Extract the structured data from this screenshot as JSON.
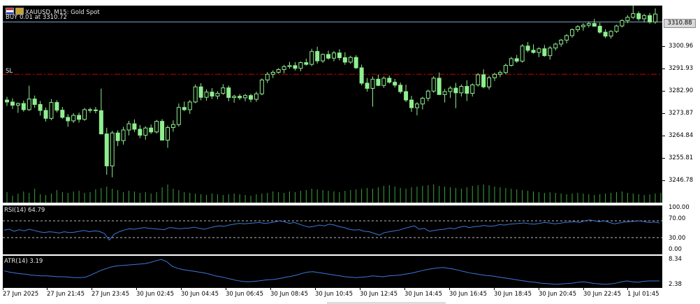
{
  "main": {
    "symbol_info": "XAUUSD, M15:  Gold Spot",
    "trade_info": "BUY 0.01 at 3310.72",
    "sl_label": "SL",
    "current_price": "3310.88",
    "price_labels": [
      "3300.96",
      "3291.93",
      "3282.90",
      "3273.87",
      "3264.84",
      "3255.81",
      "3246.78"
    ],
    "colors": {
      "bg": "#000000",
      "candle": "#90ee90",
      "sl_line": "#cc0000",
      "buy_line": "#7fa7c8",
      "volume": "#3aa63a"
    }
  },
  "rsi": {
    "label": "RSI(14) 64.79",
    "levels": [
      "100.00",
      "70.00",
      "30.00",
      "0.00"
    ],
    "series_color": "#3c78d8",
    "values": [
      48,
      50,
      45,
      49,
      46,
      50,
      47,
      44,
      42,
      44,
      43,
      41,
      44,
      42,
      43,
      45,
      47,
      44,
      46,
      45,
      40,
      24,
      38,
      44,
      48,
      51,
      50,
      52,
      54,
      52,
      51,
      50,
      49,
      54,
      53,
      51,
      52,
      53,
      55,
      52,
      50,
      53,
      56,
      58,
      57,
      60,
      62,
      64,
      63,
      64,
      65,
      66,
      64,
      65,
      67,
      70,
      68,
      64,
      66,
      62,
      58,
      55,
      57,
      60,
      58,
      62,
      60,
      56,
      54,
      50,
      48,
      49,
      45,
      44,
      40,
      36,
      42,
      44,
      46,
      48,
      52,
      55,
      58,
      50,
      52,
      45,
      47,
      49,
      50,
      53,
      51,
      55,
      57,
      54,
      56,
      57,
      59,
      57,
      58,
      61,
      60,
      62,
      63,
      64,
      65,
      63,
      62,
      64,
      66,
      65,
      63,
      64,
      66,
      67,
      68,
      66,
      70,
      72,
      70,
      68,
      70,
      66,
      63,
      65,
      67,
      68,
      69,
      70,
      68,
      66,
      67,
      65
    ]
  },
  "atr": {
    "label": "ATR(14) 3.19",
    "levels": [
      "8.34",
      "2.38"
    ],
    "series_color": "#3c78d8",
    "values": [
      5.6,
      5.3,
      5.1,
      4.9,
      4.8,
      4.6,
      4.5,
      4.4,
      4.4,
      4.3,
      4.2,
      4.2,
      4.1,
      4.0,
      4.0,
      4.1,
      4.6,
      5.2,
      5.8,
      6.2,
      6.6,
      6.8,
      6.9,
      7.0,
      7.1,
      7.2,
      7.3,
      7.6,
      8.0,
      8.3,
      7.8,
      6.7,
      6.2,
      5.9,
      5.7,
      5.5,
      5.3,
      5.1,
      4.8,
      4.4,
      4.2,
      3.9,
      3.6,
      3.3,
      3.1,
      3.0,
      3.1,
      3.2,
      3.4,
      3.5,
      3.6,
      3.8,
      4.1,
      4.3,
      4.6,
      5.0,
      5.3,
      5.4,
      5.2,
      5.0,
      4.8,
      4.6,
      4.4,
      4.2,
      4.1,
      4.0,
      4.1,
      4.2,
      4.4,
      4.3,
      4.2,
      4.4,
      4.5,
      4.6,
      4.8,
      5.0,
      5.3,
      5.6,
      5.9,
      6.1,
      6.3,
      6.4,
      6.2,
      6.0,
      5.7,
      5.4,
      5.1,
      4.9,
      4.7,
      4.5,
      4.4,
      4.2,
      4.0,
      3.8,
      3.6,
      3.4,
      3.2,
      3.0,
      2.9,
      2.7,
      2.6,
      2.5,
      2.4,
      2.5,
      2.6,
      2.7,
      2.9,
      3.0,
      2.8,
      2.6,
      2.5,
      2.4,
      2.5,
      2.7,
      3.0,
      3.2,
      3.0,
      2.9,
      3.1,
      3.2,
      3.2,
      3.2
    ]
  },
  "time_labels": [
    "27 Jun 2025",
    "27 Jun 21:45",
    "27 Jun 23:45",
    "30 Jun 02:45",
    "30 Jun 04:45",
    "30 Jun 06:45",
    "30 Jun 08:45",
    "30 Jun 10:45",
    "30 Jun 12:45",
    "30 Jun 14:45",
    "30 Jun 16:45",
    "30 Jun 18:45",
    "30 Jun 20:45",
    "30 Jun 22:45",
    "1 Jul 01:45"
  ],
  "candles": [
    [
      3279.2,
      3280.5,
      3276.8,
      3278.4
    ],
    [
      3278.4,
      3279.9,
      3275.6,
      3277.1
    ],
    [
      3277.1,
      3278.2,
      3274.0,
      3277.8
    ],
    [
      3277.8,
      3279.0,
      3274.5,
      3275.3
    ],
    [
      3275.3,
      3285.0,
      3274.8,
      3279.6
    ],
    [
      3279.6,
      3281.0,
      3276.0,
      3277.4
    ],
    [
      3277.4,
      3278.8,
      3272.9,
      3275.0
    ],
    [
      3275.0,
      3276.2,
      3270.5,
      3271.8
    ],
    [
      3271.8,
      3279.6,
      3271.0,
      3278.2
    ],
    [
      3278.2,
      3279.1,
      3274.2,
      3275.1
    ],
    [
      3275.1,
      3276.4,
      3271.6,
      3272.2
    ],
    [
      3272.2,
      3273.5,
      3268.4,
      3270.8
    ],
    [
      3270.8,
      3273.9,
      3269.9,
      3273.0
    ],
    [
      3273.0,
      3274.1,
      3270.1,
      3271.4
    ],
    [
      3271.4,
      3276.0,
      3270.8,
      3275.3
    ],
    [
      3275.3,
      3276.1,
      3274.0,
      3275.2
    ],
    [
      3275.2,
      3276.4,
      3273.8,
      3274.9
    ],
    [
      3274.9,
      3283.8,
      3273.7,
      3265.5
    ],
    [
      3265.5,
      3268.0,
      3249.0,
      3252.6
    ],
    [
      3252.6,
      3266.8,
      3248.0,
      3265.9
    ],
    [
      3265.9,
      3267.0,
      3260.6,
      3262.8
    ],
    [
      3262.8,
      3268.4,
      3261.2,
      3267.1
    ],
    [
      3267.1,
      3270.8,
      3264.9,
      3269.6
    ],
    [
      3269.6,
      3271.4,
      3266.3,
      3267.4
    ],
    [
      3267.4,
      3269.1,
      3263.8,
      3265.0
    ],
    [
      3265.0,
      3268.6,
      3263.2,
      3267.9
    ],
    [
      3267.9,
      3269.3,
      3265.5,
      3266.3
    ],
    [
      3266.3,
      3271.2,
      3265.7,
      3270.6
    ],
    [
      3270.6,
      3271.5,
      3264.0,
      3263.0
    ],
    [
      3263.0,
      3268.9,
      3259.9,
      3268.1
    ],
    [
      3268.1,
      3271.0,
      3266.4,
      3269.3
    ],
    [
      3269.3,
      3277.8,
      3268.5,
      3276.2
    ],
    [
      3276.2,
      3278.6,
      3274.7,
      3275.3
    ],
    [
      3275.3,
      3279.2,
      3273.6,
      3278.4
    ],
    [
      3278.4,
      3285.5,
      3277.9,
      3284.5
    ],
    [
      3284.5,
      3286.0,
      3279.1,
      3280.3
    ],
    [
      3280.3,
      3283.5,
      3278.9,
      3282.4
    ],
    [
      3282.4,
      3284.0,
      3279.6,
      3280.8
    ],
    [
      3280.8,
      3282.8,
      3279.5,
      3281.9
    ],
    [
      3281.9,
      3285.6,
      3281.3,
      3284.1
    ],
    [
      3284.1,
      3285.0,
      3278.7,
      3280.2
    ],
    [
      3280.2,
      3281.3,
      3278.1,
      3280.7
    ],
    [
      3280.7,
      3281.6,
      3279.2,
      3280.1
    ],
    [
      3280.1,
      3281.7,
      3278.7,
      3281.0
    ],
    [
      3281.0,
      3281.7,
      3278.3,
      3279.5
    ],
    [
      3279.5,
      3282.6,
      3278.5,
      3281.7
    ],
    [
      3281.7,
      3287.9,
      3281.1,
      3287.3
    ],
    [
      3287.3,
      3290.5,
      3286.1,
      3289.6
    ],
    [
      3289.6,
      3291.2,
      3288.1,
      3290.4
    ],
    [
      3290.4,
      3292.1,
      3289.8,
      3291.5
    ],
    [
      3291.5,
      3293.4,
      3290.0,
      3292.7
    ],
    [
      3292.7,
      3294.6,
      3291.9,
      3293.1
    ],
    [
      3293.1,
      3294.5,
      3291.1,
      3292.0
    ],
    [
      3292.0,
      3294.8,
      3290.8,
      3294.3
    ],
    [
      3294.3,
      3295.9,
      3293.1,
      3293.6
    ],
    [
      3293.6,
      3299.9,
      3292.9,
      3298.8
    ],
    [
      3298.8,
      3300.7,
      3293.9,
      3295.0
    ],
    [
      3295.0,
      3298.0,
      3294.2,
      3297.6
    ],
    [
      3297.6,
      3299.1,
      3295.5,
      3296.1
    ],
    [
      3296.1,
      3299.0,
      3294.8,
      3298.2
    ],
    [
      3298.2,
      3299.7,
      3295.2,
      3296.3
    ],
    [
      3296.3,
      3298.5,
      3293.4,
      3294.5
    ],
    [
      3294.5,
      3297.1,
      3293.8,
      3296.4
    ],
    [
      3296.4,
      3297.3,
      3291.8,
      3292.2
    ],
    [
      3292.2,
      3293.5,
      3285.1,
      3286.0
    ],
    [
      3286.0,
      3288.1,
      3282.6,
      3283.9
    ],
    [
      3283.9,
      3288.7,
      3276.5,
      3287.6
    ],
    [
      3287.6,
      3289.5,
      3284.8,
      3285.1
    ],
    [
      3285.1,
      3288.7,
      3284.1,
      3288.0
    ],
    [
      3288.0,
      3289.1,
      3285.8,
      3286.4
    ],
    [
      3286.4,
      3287.7,
      3284.2,
      3285.2
    ],
    [
      3285.2,
      3286.3,
      3281.8,
      3282.6
    ],
    [
      3282.6,
      3285.4,
      3278.4,
      3279.2
    ],
    [
      3279.2,
      3280.9,
      3274.4,
      3276.1
    ],
    [
      3276.1,
      3278.3,
      3273.0,
      3277.6
    ],
    [
      3277.6,
      3280.5,
      3275.4,
      3279.9
    ],
    [
      3279.9,
      3283.4,
      3278.7,
      3282.8
    ],
    [
      3282.8,
      3288.8,
      3282.1,
      3288.0
    ],
    [
      3288.0,
      3290.3,
      3282.2,
      3281.4
    ],
    [
      3281.4,
      3283.7,
      3278.2,
      3282.6
    ],
    [
      3282.6,
      3284.8,
      3280.0,
      3284.0
    ],
    [
      3284.0,
      3286.1,
      3275.9,
      3282.1
    ],
    [
      3282.1,
      3285.5,
      3280.6,
      3284.7
    ],
    [
      3284.7,
      3287.2,
      3278.8,
      3281.9
    ],
    [
      3281.9,
      3285.9,
      3280.6,
      3285.3
    ],
    [
      3285.3,
      3290.1,
      3284.6,
      3289.4
    ],
    [
      3289.4,
      3291.6,
      3283.9,
      3284.5
    ],
    [
      3284.5,
      3289.0,
      3283.4,
      3288.2
    ],
    [
      3288.2,
      3290.2,
      3286.9,
      3289.6
    ],
    [
      3289.6,
      3291.1,
      3288.4,
      3290.3
    ],
    [
      3290.3,
      3293.9,
      3289.6,
      3293.2
    ],
    [
      3293.2,
      3296.6,
      3292.7,
      3295.9
    ],
    [
      3295.9,
      3297.4,
      3294.2,
      3294.9
    ],
    [
      3294.9,
      3301.8,
      3294.3,
      3301.0
    ],
    [
      3301.0,
      3302.6,
      3298.5,
      3299.3
    ],
    [
      3299.3,
      3301.7,
      3297.9,
      3298.4
    ],
    [
      3298.4,
      3300.5,
      3296.5,
      3299.9
    ],
    [
      3299.9,
      3301.4,
      3296.7,
      3297.1
    ],
    [
      3297.1,
      3301.0,
      3295.5,
      3300.2
    ],
    [
      3300.2,
      3302.3,
      3299.2,
      3301.8
    ],
    [
      3301.8,
      3303.9,
      3300.7,
      3303.4
    ],
    [
      3303.4,
      3305.8,
      3302.1,
      3305.2
    ],
    [
      3305.2,
      3308.1,
      3304.4,
      3307.6
    ],
    [
      3307.6,
      3309.4,
      3306.6,
      3308.8
    ],
    [
      3308.8,
      3310.2,
      3307.2,
      3309.4
    ],
    [
      3309.4,
      3310.9,
      3308.5,
      3310.1
    ],
    [
      3310.1,
      3312.0,
      3308.8,
      3309.0
    ],
    [
      3309.0,
      3310.4,
      3306.0,
      3306.6
    ],
    [
      3306.6,
      3307.8,
      3304.2,
      3305.0
    ],
    [
      3305.0,
      3307.4,
      3304.0,
      3306.9
    ],
    [
      3306.9,
      3309.6,
      3306.3,
      3309.1
    ],
    [
      3309.1,
      3311.8,
      3308.5,
      3311.3
    ],
    [
      3311.3,
      3313.5,
      3310.2,
      3312.6
    ],
    [
      3312.6,
      3317.4,
      3311.9,
      3314.1
    ],
    [
      3314.1,
      3315.0,
      3311.2,
      3312.0
    ],
    [
      3312.0,
      3314.0,
      3310.6,
      3313.3
    ],
    [
      3313.3,
      3314.3,
      3310.0,
      3310.7
    ],
    [
      3310.7,
      3316.2,
      3310.0,
      3313.9
    ]
  ],
  "volumes": [
    0.3,
    0.2,
    0.26,
    0.32,
    0.28,
    0.4,
    0.24,
    0.22,
    0.26,
    0.36,
    0.3,
    0.28,
    0.32,
    0.34,
    0.28,
    0.3,
    0.38,
    0.42,
    0.46,
    0.4,
    0.36,
    0.3,
    0.34,
    0.32,
    0.28,
    0.3,
    0.26,
    0.3,
    0.44,
    0.52,
    0.4,
    0.36,
    0.3,
    0.28,
    0.26,
    0.24,
    0.22,
    0.26,
    0.24,
    0.22,
    0.24,
    0.26,
    0.24,
    0.22,
    0.2,
    0.24,
    0.26,
    0.28,
    0.32,
    0.3,
    0.28,
    0.32,
    0.3,
    0.34,
    0.36,
    0.4,
    0.38,
    0.36,
    0.34,
    0.32,
    0.3,
    0.34,
    0.36,
    0.38,
    0.4,
    0.42,
    0.4,
    0.44,
    0.48,
    0.5,
    0.46,
    0.42,
    0.4,
    0.44,
    0.46,
    0.48,
    0.5,
    0.52,
    0.48,
    0.46,
    0.44,
    0.42,
    0.4,
    0.44,
    0.48,
    0.5,
    0.52,
    0.5,
    0.46,
    0.44,
    0.42,
    0.4,
    0.38,
    0.36,
    0.34,
    0.32,
    0.3,
    0.28,
    0.3,
    0.28,
    0.26,
    0.24,
    0.26,
    0.28,
    0.26,
    0.24,
    0.22,
    0.24,
    0.26,
    0.28,
    0.3,
    0.32,
    0.28,
    0.26,
    0.24,
    0.22,
    0.24,
    0.26,
    0.28,
    0.3,
    0.32
  ]
}
